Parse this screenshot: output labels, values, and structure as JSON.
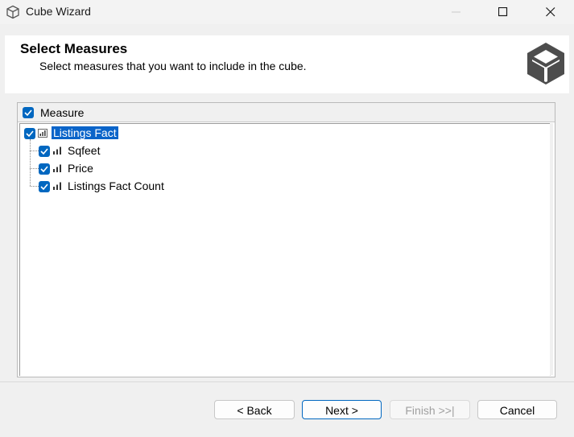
{
  "window": {
    "title": "Cube Wizard"
  },
  "header": {
    "title": "Select Measures",
    "subtitle": "Select measures that you want to include in the cube."
  },
  "grid": {
    "column_header": "Measure",
    "column_header_checked": true,
    "tree": {
      "label": "Listings Fact",
      "checked": true,
      "selected": true,
      "icon": "measure-group-icon",
      "children": [
        {
          "label": "Sqfeet",
          "checked": true,
          "icon": "measure-icon"
        },
        {
          "label": "Price",
          "checked": true,
          "icon": "measure-icon"
        },
        {
          "label": "Listings Fact Count",
          "checked": true,
          "icon": "measure-icon"
        }
      ]
    }
  },
  "buttons": {
    "back": "< Back",
    "next": "Next >",
    "finish": "Finish >>|",
    "cancel": "Cancel"
  },
  "colors": {
    "accent": "#0067c0",
    "selection": "#0a64c9"
  }
}
